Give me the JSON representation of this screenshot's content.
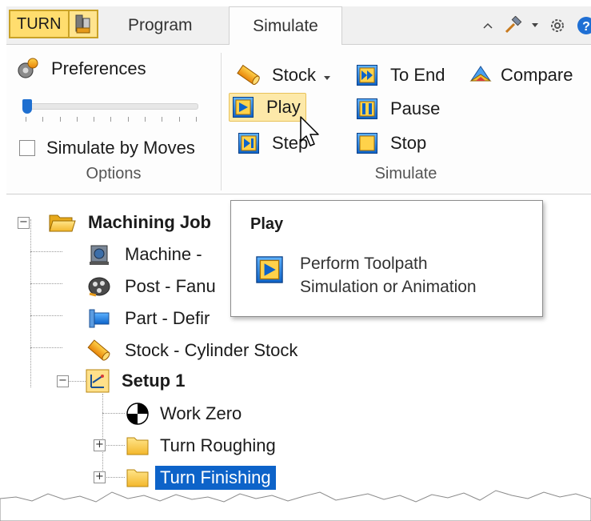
{
  "tabs": {
    "app_label": "TURN",
    "program": "Program",
    "simulate": "Simulate"
  },
  "quick_access": [
    {
      "icon": "chevron-up-icon"
    },
    {
      "icon": "hammer-icon"
    },
    {
      "icon": "dropdown-arrow-icon"
    },
    {
      "icon": "gear-icon"
    },
    {
      "icon": "help-icon"
    }
  ],
  "ribbon": {
    "options": {
      "preferences": "Preferences",
      "slider_position": 0,
      "simulate_by_moves": "Simulate by Moves",
      "simulate_by_moves_checked": false,
      "label": "Options"
    },
    "simulate": {
      "stock": "Stock",
      "to_end": "To End",
      "compare": "Compare",
      "play": "Play",
      "pause": "Pause",
      "step": "Step",
      "stop": "Stop",
      "label": "Simulate"
    }
  },
  "tree": {
    "machining_job": "Machining Job",
    "machine": "Machine -",
    "post": "Post - Fanu",
    "part": "Part - Defir",
    "stock": "Stock - Cylinder Stock",
    "setup": "Setup 1",
    "work_zero": "Work Zero",
    "turn_roughing": "Turn Roughing",
    "turn_finishing": "Turn Finishing"
  },
  "tooltip": {
    "title": "Play",
    "line1": "Perform Toolpath",
    "line2": "Simulation or Animation"
  },
  "colors": {
    "accent_blue": "#1e6fd0",
    "selection": "#0d63c9",
    "highlight": "#fde9a9",
    "app_tab": "#ffdd6e"
  }
}
